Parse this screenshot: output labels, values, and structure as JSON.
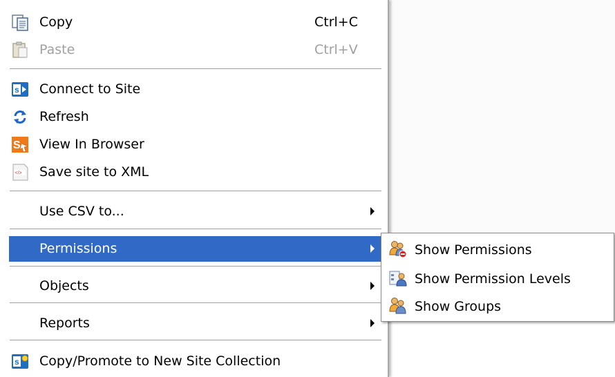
{
  "context_menu": {
    "copy": {
      "label": "Copy",
      "shortcut": "Ctrl+C",
      "icon": "copy-icon"
    },
    "paste": {
      "label": "Paste",
      "shortcut": "Ctrl+V",
      "icon": "paste-icon"
    },
    "connect": {
      "label": "Connect to Site",
      "icon": "sharepoint-icon"
    },
    "refresh": {
      "label": "Refresh",
      "icon": "refresh-icon"
    },
    "view_browser": {
      "label": "View In Browser",
      "icon": "browser-icon"
    },
    "save_xml": {
      "label": "Save site to XML",
      "icon": "xml-icon"
    },
    "csv": {
      "label": "Use CSV to..."
    },
    "permissions": {
      "label": "Permissions"
    },
    "objects": {
      "label": "Objects"
    },
    "reports": {
      "label": "Reports"
    },
    "copy_promote": {
      "label": "Copy/Promote to New Site Collection",
      "icon": "sharepoint-new-icon"
    }
  },
  "submenu": {
    "show_permissions": {
      "label": "Show Permissions",
      "icon": "users-remove-icon"
    },
    "show_permission_levels": {
      "label": "Show Permission Levels",
      "icon": "permission-levels-icon"
    },
    "show_groups": {
      "label": "Show Groups",
      "icon": "users-group-icon"
    }
  },
  "colors": {
    "highlight": "#3169c6",
    "disabled_text": "#a0a0a0"
  }
}
